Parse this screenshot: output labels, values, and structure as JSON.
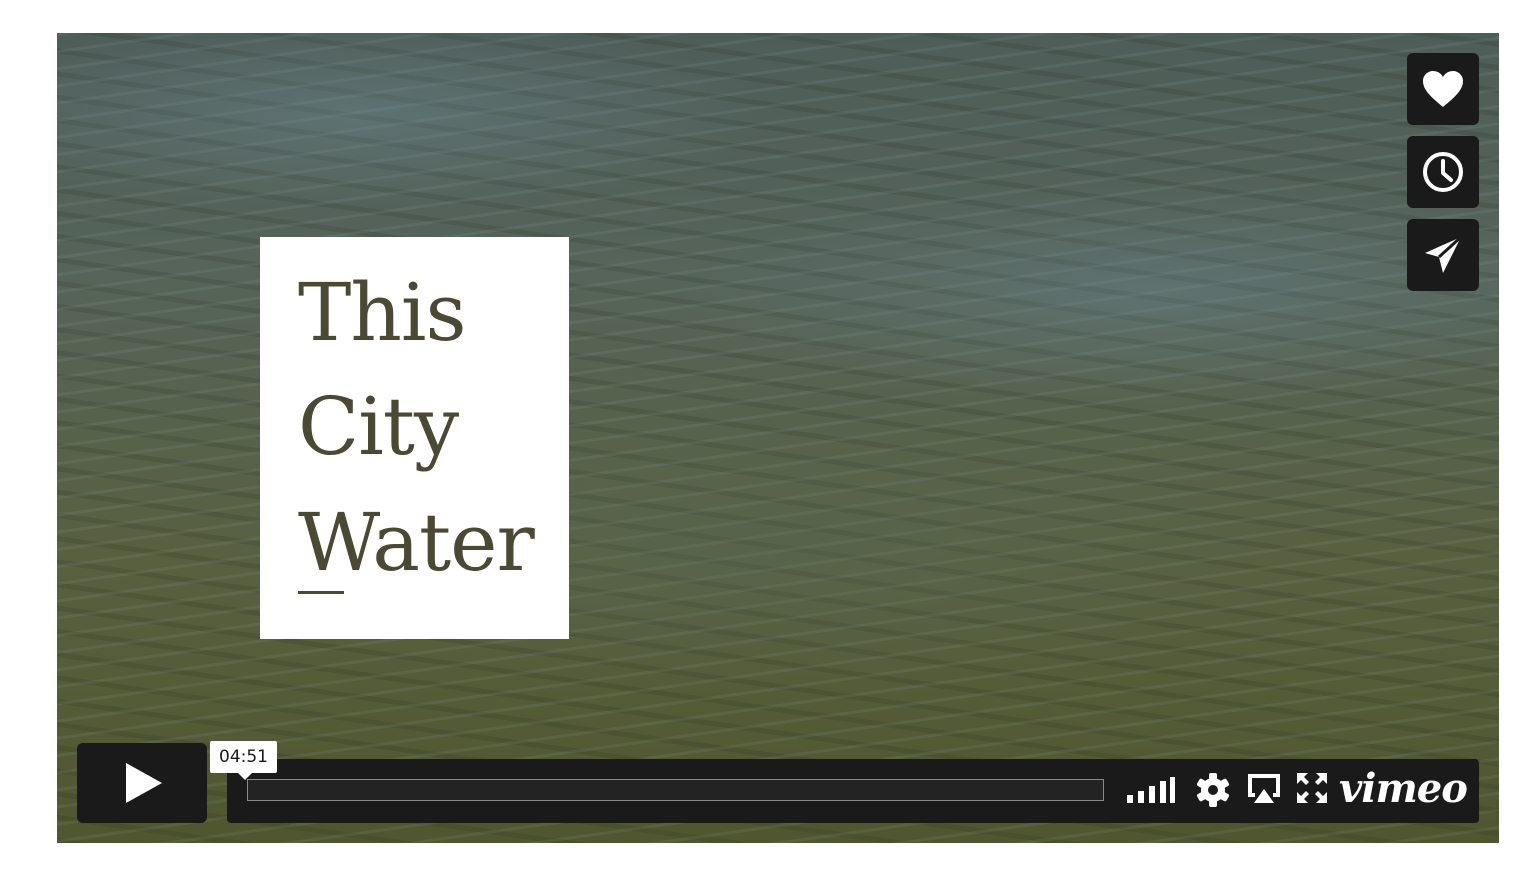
{
  "video": {
    "title_card": {
      "line1": "This",
      "line2": "City",
      "line3": "Water"
    }
  },
  "side_actions": {
    "like_icon": "heart-icon",
    "watch_later_icon": "clock-icon",
    "share_icon": "paper-plane-icon"
  },
  "controls": {
    "play_icon": "play-icon",
    "duration": "04:51",
    "progress": 0,
    "quality_icon": "signal-bars-icon",
    "settings_icon": "gear-icon",
    "airplay_icon": "airplay-icon",
    "fullscreen_icon": "fullscreen-icon",
    "logo": "vimeo"
  },
  "colors": {
    "control_bg": "#1a1a1a",
    "card_text": "#4a4a34",
    "icon": "#ffffff"
  }
}
